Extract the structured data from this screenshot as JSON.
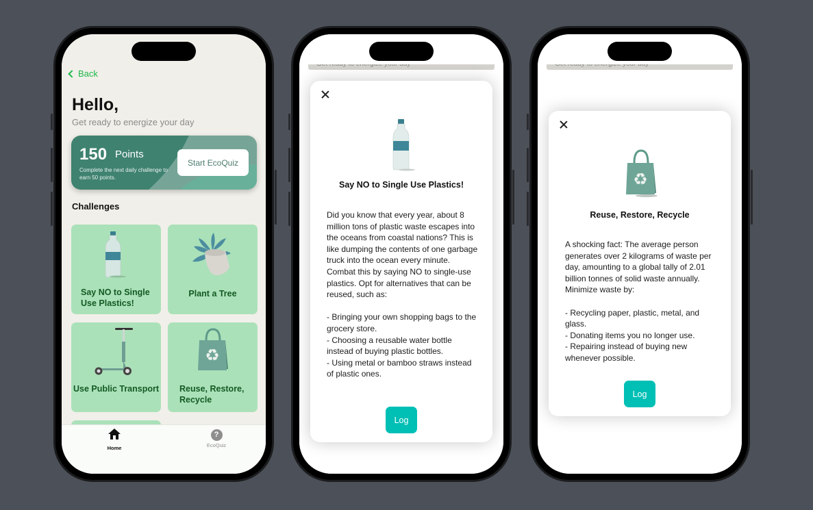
{
  "colors": {
    "background": "#4c5058",
    "accent_green": "#1eb84a",
    "tile_bg": "#abe1b9",
    "tile_text": "#135a23",
    "points_card": "#3f8270",
    "log_button": "#00bfb5"
  },
  "home": {
    "back_label": "Back",
    "greeting": "Hello,",
    "subtitle": "Get ready to energize your day",
    "points": {
      "value": "150",
      "unit": "Points",
      "description": "Complete the next daily challenge to earn 50 points.",
      "button_label": "Start EcoQuiz"
    },
    "challenges_title": "Challenges",
    "challenges": [
      {
        "label": "Say NO to Single Use Plastics!",
        "icon": "water-bottle"
      },
      {
        "label": "Plant a Tree",
        "icon": "potted-plant"
      },
      {
        "label": "Use Public Transport",
        "icon": "scooter"
      },
      {
        "label": "Reuse, Restore, Recycle",
        "icon": "recycle-bag"
      }
    ],
    "tabs": [
      {
        "label": "Home",
        "icon": "house-icon",
        "active": true
      },
      {
        "label": "EcoQuiz",
        "icon": "question-circle-icon",
        "active": false
      }
    ]
  },
  "peek_text": "Get ready to energize your day",
  "modal_plastics": {
    "icon": "water-bottle",
    "title": "Say NO to Single Use Plastics!",
    "body": "Did you know that every year, about 8 million tons of plastic waste escapes into the oceans from coastal nations? This is like dumping the contents of one garbage truck into the ocean every minute. Combat this by saying NO to single-use plastics. Opt for alternatives that can be reused, such as:\n\n- Bringing your own shopping bags to the grocery store.\n- Choosing a reusable water bottle instead of buying plastic bottles.\n- Using metal or bamboo straws instead of plastic ones.",
    "button_label": "Log"
  },
  "modal_recycle": {
    "icon": "recycle-bag",
    "title": "Reuse, Restore, Recycle",
    "body": "A shocking fact: The average person generates over 2 kilograms of waste per day, amounting to a global tally of 2.01 billion tonnes of solid waste annually. Minimize waste by:\n\n- Recycling paper, plastic, metal, and glass.\n- Donating items you no longer use.\n- Repairing instead of buying new whenever possible.",
    "button_label": "Log"
  }
}
